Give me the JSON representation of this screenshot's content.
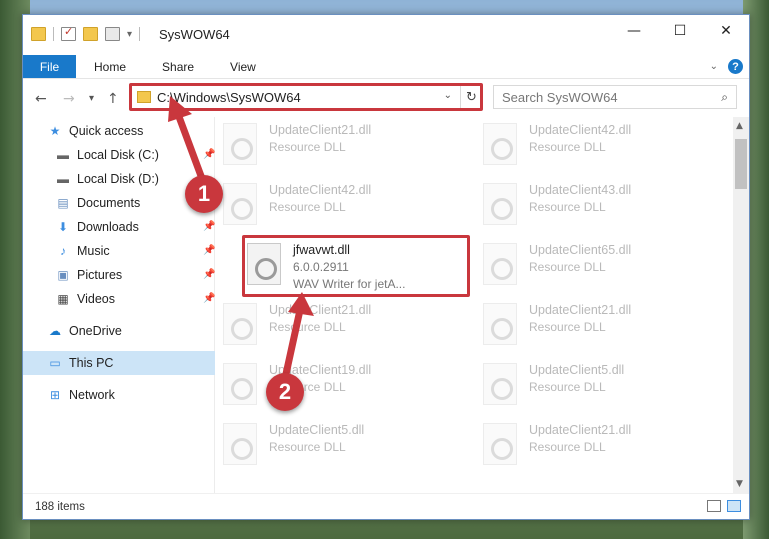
{
  "window": {
    "title": "SysWOW64",
    "controls": {
      "minimize": "—",
      "maximize": "☐",
      "close": "✕"
    }
  },
  "ribbon": {
    "tabs": [
      "File",
      "Home",
      "Share",
      "View"
    ],
    "help": "?",
    "expand": "⌄"
  },
  "address": {
    "path": "C:\\Windows\\SysWOW64",
    "search_placeholder": "Search SysWOW64"
  },
  "sidebar": {
    "items": [
      {
        "label": "Quick access",
        "icon": "star-icon"
      },
      {
        "label": "Local Disk (C:)",
        "icon": "drive-icon"
      },
      {
        "label": "Local Disk (D:)",
        "icon": "drive-icon"
      },
      {
        "label": "Documents",
        "icon": "documents-icon"
      },
      {
        "label": "Downloads",
        "icon": "download-icon"
      },
      {
        "label": "Music",
        "icon": "music-icon"
      },
      {
        "label": "Pictures",
        "icon": "pictures-icon"
      },
      {
        "label": "Videos",
        "icon": "videos-icon"
      },
      {
        "label": "OneDrive",
        "icon": "cloud-icon"
      },
      {
        "label": "This PC",
        "icon": "computer-icon"
      },
      {
        "label": "Network",
        "icon": "network-icon"
      }
    ]
  },
  "files": [
    {
      "name": "UpdateClient21.dll",
      "sub": "Resource DLL"
    },
    {
      "name": "UpdateClient42.dll",
      "sub": "Resource DLL"
    },
    {
      "name": "UpdateClient42.dll",
      "sub": "Resource DLL"
    },
    {
      "name": "UpdateClient43.dll",
      "sub": "Resource DLL"
    },
    {
      "name": "jfwavwt.dll",
      "sub": "6.0.0.2911",
      "sub2": "WAV Writer for jetA..."
    },
    {
      "name": "UpdateClient65.dll",
      "sub": "Resource DLL"
    },
    {
      "name": "UpdateClient21.dll",
      "sub": "Resource DLL"
    },
    {
      "name": "UpdateClient21.dll",
      "sub": "Resource DLL"
    },
    {
      "name": "UpdateClient19.dll",
      "sub": "Resource DLL"
    },
    {
      "name": "UpdateClient5.dll",
      "sub": "Resource DLL"
    },
    {
      "name": "UpdateClient5.dll",
      "sub": "Resource DLL"
    },
    {
      "name": "UpdateClient21.dll",
      "sub": "Resource DLL"
    }
  ],
  "status": {
    "count": "188 items"
  },
  "callouts": {
    "one": "1",
    "two": "2"
  },
  "colors": {
    "accent": "#1979ca",
    "highlight": "#c9373d",
    "selected": "#cce4f7"
  }
}
